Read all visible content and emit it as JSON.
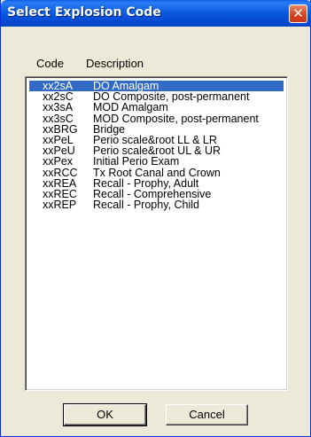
{
  "window": {
    "title": "Select Explosion Code",
    "close_glyph": "✕",
    "icon": "close-icon"
  },
  "list": {
    "headers": {
      "code": "Code",
      "description": "Description"
    },
    "selected_index": 0,
    "items": [
      {
        "code": "xx2sA",
        "description": "DO Amalgam"
      },
      {
        "code": "xx2sC",
        "description": "DO Composite, post-permanent"
      },
      {
        "code": "xx3sA",
        "description": "MOD Amalgam"
      },
      {
        "code": "xx3sC",
        "description": "MOD Composite, post-permanent"
      },
      {
        "code": "xxBRG",
        "description": "Bridge"
      },
      {
        "code": "xxPeL",
        "description": "Perio scale&root LL & LR"
      },
      {
        "code": "xxPeU",
        "description": "Perio scale&root UL & UR"
      },
      {
        "code": "xxPex",
        "description": "Initial Perio Exam"
      },
      {
        "code": "xxRCC",
        "description": "Tx Root Canal and Crown"
      },
      {
        "code": "xxREA",
        "description": "Recall - Prophy, Adult"
      },
      {
        "code": "xxREC",
        "description": "Recall - Comprehensive"
      },
      {
        "code": "xxREP",
        "description": "Recall - Prophy, Child"
      }
    ]
  },
  "buttons": {
    "ok": "OK",
    "cancel": "Cancel"
  },
  "colors": {
    "selection": "#316ac5",
    "titlebar": "#0a58e0",
    "dialog": "#ece9d8"
  }
}
